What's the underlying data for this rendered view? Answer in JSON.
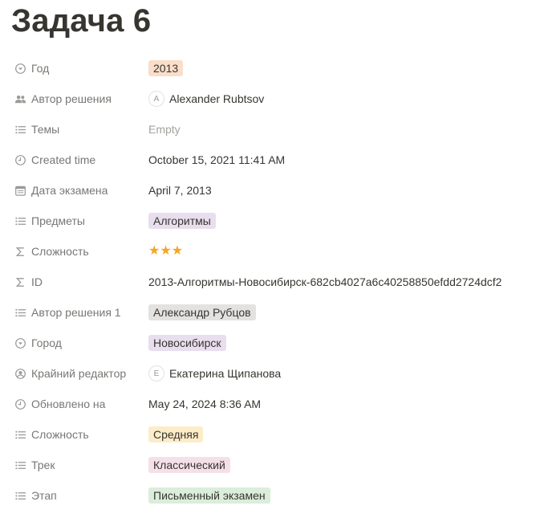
{
  "page": {
    "title": "Задача 6"
  },
  "colors": {
    "tag_orange": "#fadec9",
    "tag_purple": "#e8deee",
    "tag_gray": "#e3e2e0",
    "tag_yellow": "#fdecc8",
    "tag_red": "#f5e0e9",
    "tag_green": "#dbeddb",
    "star": "#f5a623"
  },
  "properties": [
    {
      "name": "Год",
      "icon": "select-icon",
      "type": "tag",
      "value": "2013",
      "color": "#fadec9"
    },
    {
      "name": "Автор решения",
      "icon": "people-icon",
      "type": "person",
      "initial": "A",
      "value": "Alexander Rubtsov"
    },
    {
      "name": "Темы",
      "icon": "list-icon",
      "type": "empty",
      "value": "Empty"
    },
    {
      "name": "Created time",
      "icon": "clock-icon",
      "type": "text",
      "value": "October 15, 2021 11:41 AM"
    },
    {
      "name": "Дата экзамена",
      "icon": "calendar-icon",
      "type": "text",
      "value": "April 7, 2013"
    },
    {
      "name": "Предметы",
      "icon": "list-icon",
      "type": "tag",
      "value": "Алгоритмы",
      "color": "#e8deee"
    },
    {
      "name": "Сложность",
      "icon": "formula-icon",
      "type": "stars",
      "value": "★★★",
      "rating": 3
    },
    {
      "name": "ID",
      "icon": "formula-icon",
      "type": "text",
      "value": "2013-Алгоритмы-Новосибирск-682cb4027a6c40258850efdd2724dcf2"
    },
    {
      "name": "Автор решения 1",
      "icon": "list-icon",
      "type": "tag",
      "value": "Александр Рубцов",
      "color": "#e3e2e0"
    },
    {
      "name": "Город",
      "icon": "select-icon",
      "type": "tag",
      "value": "Новосибирск",
      "color": "#e8deee"
    },
    {
      "name": "Крайний редактор",
      "icon": "user-circle-icon",
      "type": "person",
      "initial": "E",
      "value": "Екатерина Щипанова"
    },
    {
      "name": "Обновлено на",
      "icon": "clock-icon",
      "type": "text",
      "value": "May 24, 2024 8:36 AM"
    },
    {
      "name": "Сложность",
      "icon": "list-icon",
      "type": "tag",
      "value": "Средняя",
      "color": "#fdecc8"
    },
    {
      "name": "Трек",
      "icon": "list-icon",
      "type": "tag",
      "value": "Классический",
      "color": "#f5e0e9"
    },
    {
      "name": "Этап",
      "icon": "list-icon",
      "type": "tag",
      "value": "Письменный экзамен",
      "color": "#dbeddb"
    }
  ]
}
